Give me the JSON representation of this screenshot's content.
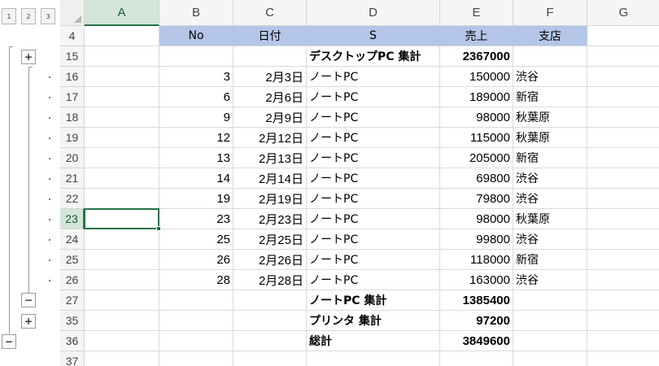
{
  "outline_levels": [
    "1",
    "2",
    "3"
  ],
  "outline_buttons": {
    "plus": "+",
    "minus": "−"
  },
  "columns": [
    "A",
    "B",
    "C",
    "D",
    "E",
    "F",
    "G"
  ],
  "selected_column": "A",
  "selected_row": "23",
  "rows": [
    {
      "num": "4",
      "A": "",
      "B": "No",
      "C": "日付",
      "D": "S",
      "E": "売上",
      "F": "支店",
      "G": "",
      "header": true
    },
    {
      "num": "15",
      "A": "",
      "B": "",
      "C": "",
      "D": "デスクトップPC 集計",
      "E": "2367000",
      "F": "",
      "G": "",
      "bold": true
    },
    {
      "num": "16",
      "A": "",
      "B": "3",
      "C": "2月3日",
      "D": "ノートPC",
      "E": "150000",
      "F": "渋谷",
      "G": ""
    },
    {
      "num": "17",
      "A": "",
      "B": "6",
      "C": "2月6日",
      "D": "ノートPC",
      "E": "189000",
      "F": "新宿",
      "G": ""
    },
    {
      "num": "18",
      "A": "",
      "B": "9",
      "C": "2月9日",
      "D": "ノートPC",
      "E": "98000",
      "F": "秋葉原",
      "G": ""
    },
    {
      "num": "19",
      "A": "",
      "B": "12",
      "C": "2月12日",
      "D": "ノートPC",
      "E": "115000",
      "F": "秋葉原",
      "G": ""
    },
    {
      "num": "20",
      "A": "",
      "B": "13",
      "C": "2月13日",
      "D": "ノートPC",
      "E": "205000",
      "F": "新宿",
      "G": ""
    },
    {
      "num": "21",
      "A": "",
      "B": "14",
      "C": "2月14日",
      "D": "ノートPC",
      "E": "69800",
      "F": "渋谷",
      "G": ""
    },
    {
      "num": "22",
      "A": "",
      "B": "19",
      "C": "2月19日",
      "D": "ノートPC",
      "E": "79800",
      "F": "渋谷",
      "G": ""
    },
    {
      "num": "23",
      "A": "",
      "B": "23",
      "C": "2月23日",
      "D": "ノートPC",
      "E": "98000",
      "F": "秋葉原",
      "G": ""
    },
    {
      "num": "24",
      "A": "",
      "B": "25",
      "C": "2月25日",
      "D": "ノートPC",
      "E": "99800",
      "F": "渋谷",
      "G": ""
    },
    {
      "num": "25",
      "A": "",
      "B": "26",
      "C": "2月26日",
      "D": "ノートPC",
      "E": "118000",
      "F": "新宿",
      "G": ""
    },
    {
      "num": "26",
      "A": "",
      "B": "28",
      "C": "2月28日",
      "D": "ノートPC",
      "E": "163000",
      "F": "渋谷",
      "G": ""
    },
    {
      "num": "27",
      "A": "",
      "B": "",
      "C": "",
      "D": "ノートPC 集計",
      "E": "1385400",
      "F": "",
      "G": "",
      "bold": true
    },
    {
      "num": "35",
      "A": "",
      "B": "",
      "C": "",
      "D": "プリンタ 集計",
      "E": "97200",
      "F": "",
      "G": "",
      "bold": true
    },
    {
      "num": "36",
      "A": "",
      "B": "",
      "C": "",
      "D": "総計",
      "E": "3849600",
      "F": "",
      "G": "",
      "bold": true
    },
    {
      "num": "37",
      "A": "",
      "B": "",
      "C": "",
      "D": "",
      "E": "",
      "F": "",
      "G": ""
    }
  ]
}
